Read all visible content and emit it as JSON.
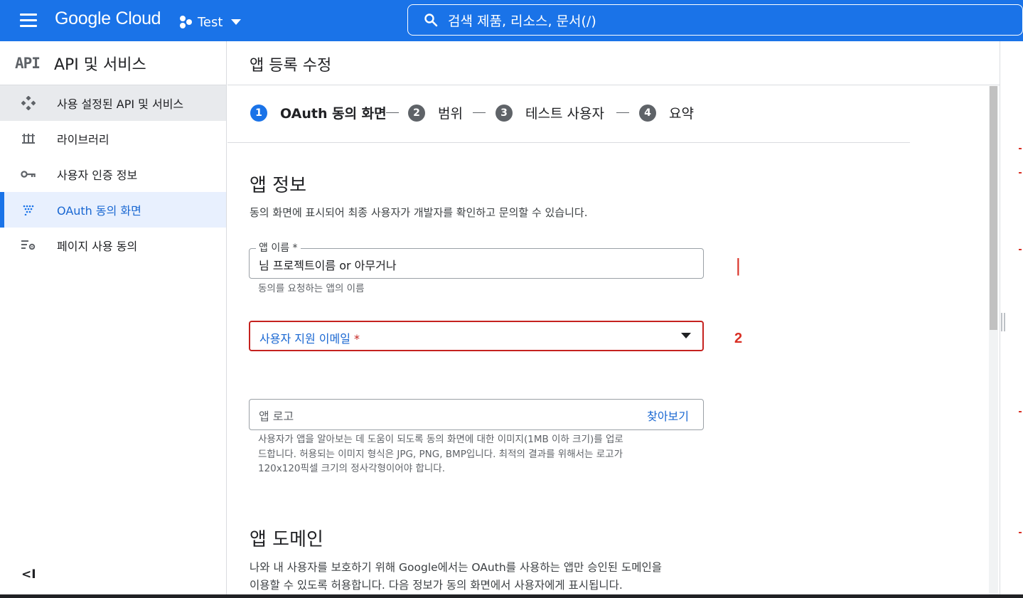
{
  "topbar": {
    "brand": "Google Cloud",
    "project": "Test",
    "search_placeholder": "검색   제품, 리소스, 문서(/)"
  },
  "sidebar": {
    "logo": "API",
    "title": "API 및 서비스",
    "items": [
      {
        "label": "사용 설정된 API 및 서비스",
        "icon": "api-diamond-icon"
      },
      {
        "label": "라이브러리",
        "icon": "library-icon"
      },
      {
        "label": "사용자 인증 정보",
        "icon": "key-icon"
      },
      {
        "label": "OAuth 동의 화면",
        "icon": "oauth-dots-icon"
      },
      {
        "label": "페이지 사용 동의",
        "icon": "settings-list-icon"
      }
    ],
    "collapse_label": "<I"
  },
  "page": {
    "title": "앱 등록 수정",
    "steps": [
      {
        "num": "1",
        "label": "OAuth 동의 화면"
      },
      {
        "num": "2",
        "label": "범위"
      },
      {
        "num": "3",
        "label": "테스트 사용자"
      },
      {
        "num": "4",
        "label": "요약"
      }
    ],
    "step_separator": "—"
  },
  "app_info": {
    "heading": "앱 정보",
    "description": "동의 화면에 표시되어 최종 사용자가 개발자를 확인하고 문의할 수 있습니다.",
    "app_name_label": "앱 이름 *",
    "app_name_value": "님 프로젝트이름 or 아무거나",
    "app_name_hint": "동의를 요청하는 앱의 이름",
    "support_email_label": "사용자 지원 이메일",
    "support_email_required": "*",
    "logo_label": "앱 로고",
    "logo_browse": "찾아보기",
    "logo_hint_1": "사용자가 앱을 알아보는 데 도움이 되도록 동의 화면에 대한 이미지(1MB 이하 크기)를 업로",
    "logo_hint_2": "드합니다. 허용되는 이미지 형식은 JPG, PNG, BMP입니다. 최적의 결과를 위해서는 로고가",
    "logo_hint_3": "120x120픽셀 크기의 정사각형이어야 합니다."
  },
  "app_domain": {
    "heading": "앱 도메인",
    "description_1": "나와 내 사용자를 보호하기 위해 Google에서는 OAuth를 사용하는 앱만 승인된 도메인을",
    "description_2": "이용할 수 있도록 허용합니다. 다음 정보가 동의 화면에서 사용자에게 표시됩니다."
  },
  "annotations": {
    "mark_1": "|",
    "mark_2": "2"
  },
  "colors": {
    "primary": "#1a73e8",
    "error": "#c5221f",
    "annotation": "#d93025"
  }
}
